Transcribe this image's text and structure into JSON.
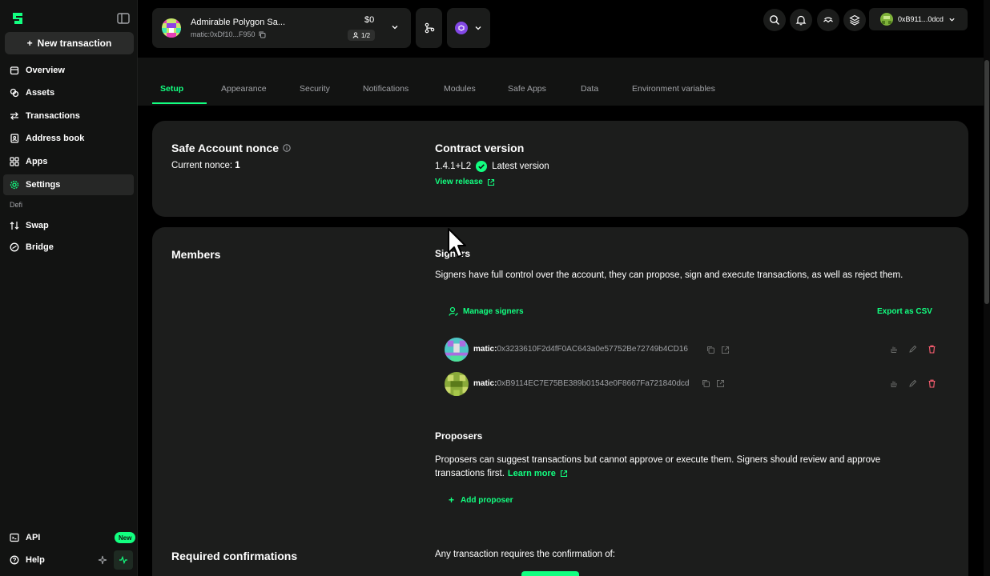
{
  "sidebar": {
    "new_tx_label": "New transaction",
    "items": [
      {
        "label": "Overview",
        "icon": "home-icon"
      },
      {
        "label": "Assets",
        "icon": "coins-icon"
      },
      {
        "label": "Transactions",
        "icon": "arrows-icon"
      },
      {
        "label": "Address book",
        "icon": "book-icon"
      },
      {
        "label": "Apps",
        "icon": "grid-icon"
      },
      {
        "label": "Settings",
        "icon": "gear-icon",
        "active": true
      }
    ],
    "section_label": "Defi",
    "defi_items": [
      {
        "label": "Swap",
        "icon": "swap-icon"
      },
      {
        "label": "Bridge",
        "icon": "bridge-icon"
      }
    ],
    "bottom": {
      "api_label": "API",
      "api_badge": "New",
      "help_label": "Help"
    }
  },
  "header": {
    "safe_name": "Admirable Polygon Sa...",
    "safe_address": "matic:0xDf10...F950",
    "balance": "$0",
    "threshold": "1/2",
    "wallet_address": "0xB911...0dcd"
  },
  "tabs": [
    "Setup",
    "Appearance",
    "Security",
    "Notifications",
    "Modules",
    "Safe Apps",
    "Data",
    "Environment variables"
  ],
  "nonce": {
    "title": "Safe Account nonce",
    "current_label": "Current nonce:",
    "current_value": "1"
  },
  "contract": {
    "title": "Contract version",
    "version": "1.4.1+L2",
    "status": "Latest version",
    "link": "View release"
  },
  "members": {
    "title": "Members",
    "signers_title": "Signers",
    "signers_desc": "Signers have full control over the account, they can propose, sign and execute transactions, as well as reject them.",
    "manage_label": "Manage signers",
    "export_label": "Export as CSV",
    "signers": [
      {
        "prefix": "matic:",
        "address": "0x3233610F2d4fF0AC643a0e57752Be72749b4CD16"
      },
      {
        "prefix": "matic:",
        "address": "0xB9114EC7E75BE389b01543e0F8667Fa721840dcd"
      }
    ],
    "proposers_title": "Proposers",
    "proposers_desc_1": "Proposers can suggest transactions but cannot approve or execute them. Signers should review and approve",
    "proposers_desc_2": "transactions first.",
    "learn_more": "Learn more",
    "add_proposer": "Add proposer"
  },
  "confirmations": {
    "title": "Required confirmations",
    "desc": "Any transaction requires the confirmation of:"
  },
  "colors": {
    "accent": "#12ff80",
    "danger": "#ff5f72",
    "card": "#1c1d1c",
    "sidebar": "#121312"
  }
}
